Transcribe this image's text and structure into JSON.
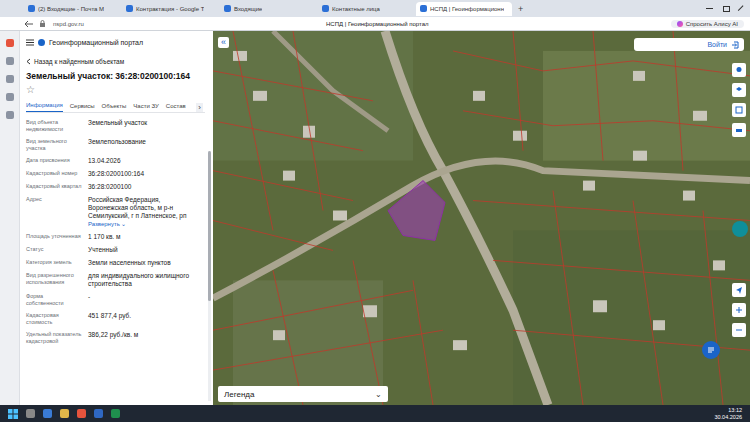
{
  "browser": {
    "tabs": [
      {
        "label": "(2) Входящие - Почта М",
        "selected": false
      },
      {
        "label": "Контрактация - Google Т",
        "selected": false
      },
      {
        "label": "Входящие",
        "selected": false
      },
      {
        "label": "Контактные лица",
        "selected": false
      },
      {
        "label": "НСПД | Геоинформационн",
        "selected": true
      }
    ],
    "new_tab": "+",
    "address": "nspd.gov.ru",
    "page_title": "НСПД | Геоинформационный портал",
    "alice": "Спросить Алису AI"
  },
  "portal": {
    "title": "Геоинформационный портал",
    "back": "Назад к найденным объектам",
    "heading": "Земельный участок: 36:28:0200100:164",
    "star": "☆",
    "tabs": [
      {
        "label": "Информация",
        "selected": true
      },
      {
        "label": "Сервисы",
        "selected": false
      },
      {
        "label": "Объекты",
        "selected": false
      },
      {
        "label": "Части ЗУ",
        "selected": false
      },
      {
        "label": "Состав",
        "selected": false
      }
    ],
    "tabs_more": "›",
    "fields": [
      {
        "label": "Вид объекта недвижимости",
        "value": "Земельный участок"
      },
      {
        "label": "Вид земельного участка",
        "value": "Землепользование"
      },
      {
        "label": "Дата присвоения",
        "value": "13.04.2026"
      },
      {
        "label": "Кадастровый номер",
        "value": "36:28:0200100:164"
      },
      {
        "label": "Кадастровый квартал",
        "value": "36:28:0200100"
      },
      {
        "label": "Адрес",
        "value": "Российская Федерация, Воронежская область, м р-н Семилукский, г п Латненское, рп",
        "link": "Развернуть"
      },
      {
        "label": "Площадь уточненная",
        "value": "1 170 кв. м"
      },
      {
        "label": "Статус",
        "value": "Учтенный"
      },
      {
        "label": "Категория земель",
        "value": "Земли населенных пунктов"
      },
      {
        "label": "Вид разрешенного использования",
        "value": "для индивидуального жилищного строительства"
      },
      {
        "label": "Форма собственности",
        "value": "-"
      },
      {
        "label": "Кадастровая стоимость",
        "value": "451 877,4 руб."
      },
      {
        "label": "Удельный показатель кадастровой",
        "value": "386,22 руб./кв. м"
      }
    ]
  },
  "map": {
    "collapse": "«",
    "login": "Войти",
    "legend": "Легенда",
    "legend_chevron": "⌄"
  },
  "taskbar": {
    "time": "13:12",
    "date": "30.04.2026"
  }
}
